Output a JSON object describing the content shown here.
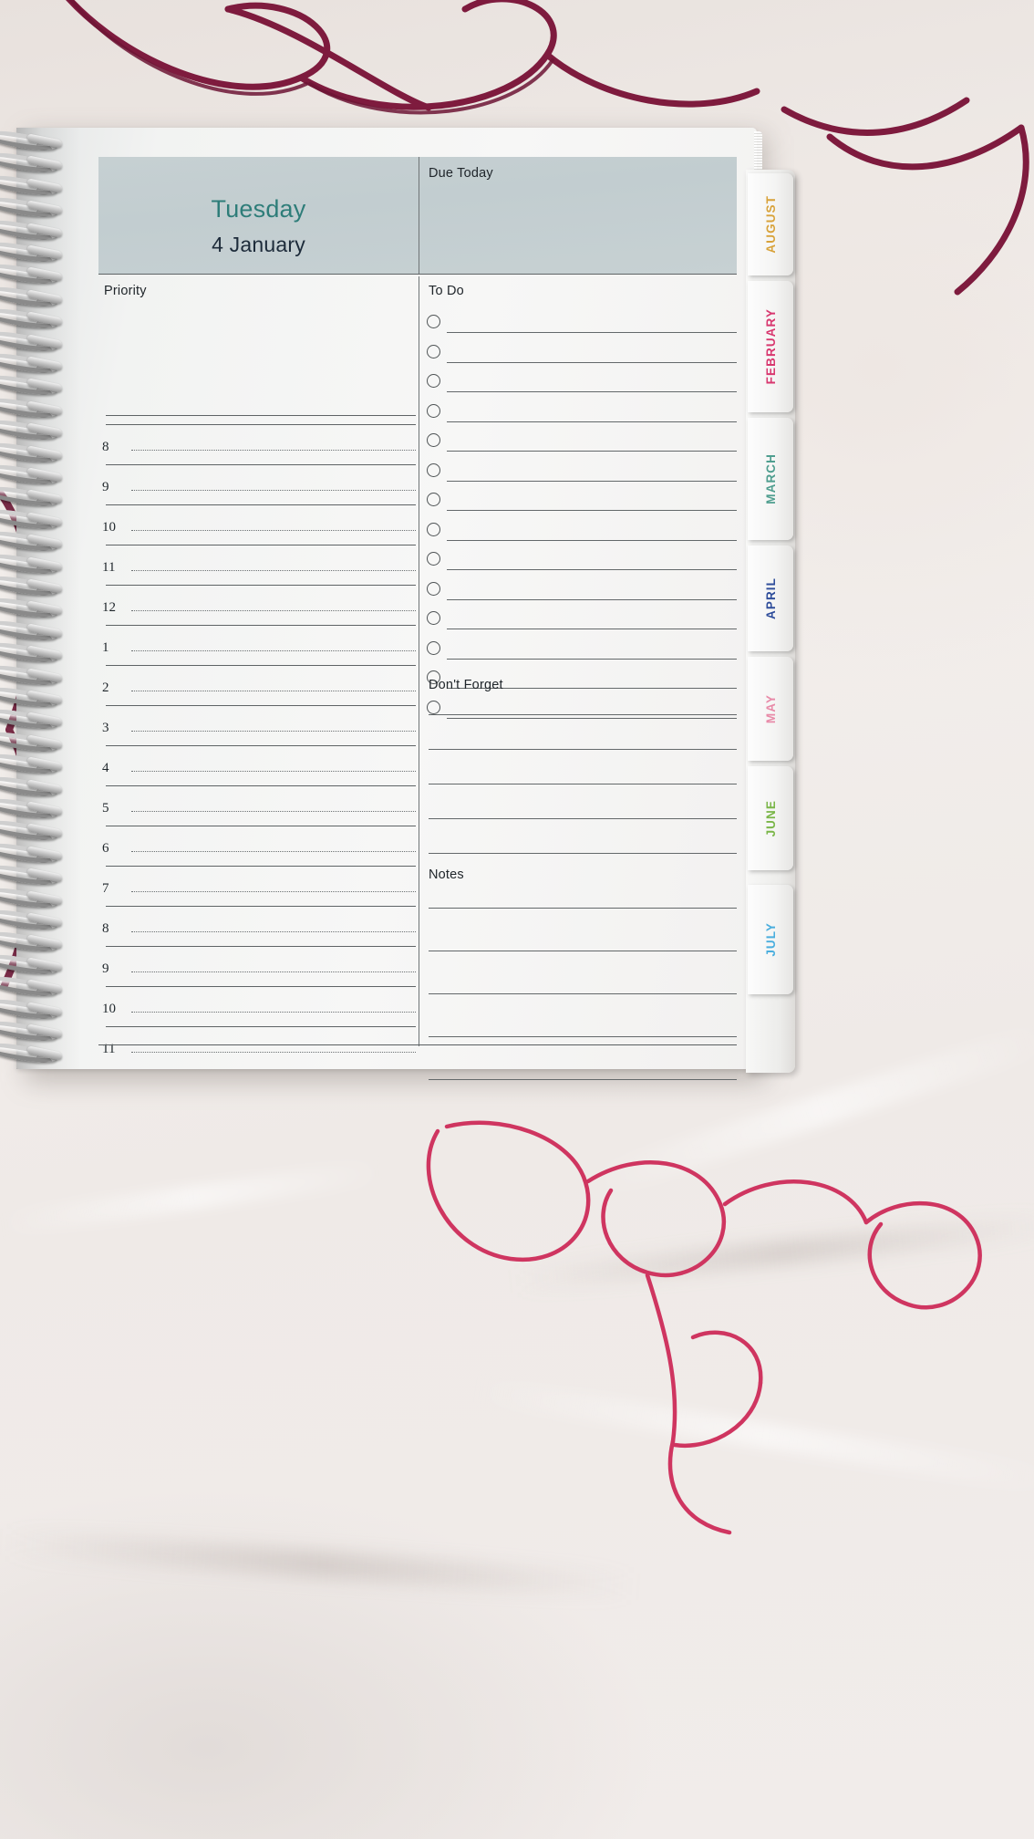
{
  "page": {
    "type": "daily-planner-page",
    "header": {
      "weekday": "Tuesday",
      "date": "4 January",
      "due_today_label": "Due Today"
    },
    "sections": {
      "priority_label": "Priority",
      "todo_label": "To Do",
      "dont_forget_label": "Don't Forget",
      "notes_label": "Notes"
    },
    "schedule": {
      "hours": [
        "8",
        "9",
        "10",
        "11",
        "12",
        "1",
        "2",
        "3",
        "4",
        "5",
        "6",
        "7",
        "8",
        "9",
        "10",
        "11"
      ]
    },
    "todo": {
      "checkbox_count": 14,
      "checked": []
    },
    "dont_forget": {
      "line_count": 5
    },
    "notes": {
      "line_count": 5
    },
    "colors": {
      "header_band": "#c4cfd1",
      "weekday_text": "#2e7d79",
      "date_text": "#1d2b3a",
      "rule": "#5e6365",
      "paper": "#f5f5f4"
    }
  },
  "tabs": [
    {
      "label": "AUGUST",
      "color": "#d8a23a"
    },
    {
      "label": "FEBRUARY",
      "color": "#d8376f"
    },
    {
      "label": "MARCH",
      "color": "#4f9e8f"
    },
    {
      "label": "APRIL",
      "color": "#2f4d9b"
    },
    {
      "label": "MAY",
      "color": "#e88aa8"
    },
    {
      "label": "JUNE",
      "color": "#7ab648"
    },
    {
      "label": "JULY",
      "color": "#4aaede"
    }
  ]
}
